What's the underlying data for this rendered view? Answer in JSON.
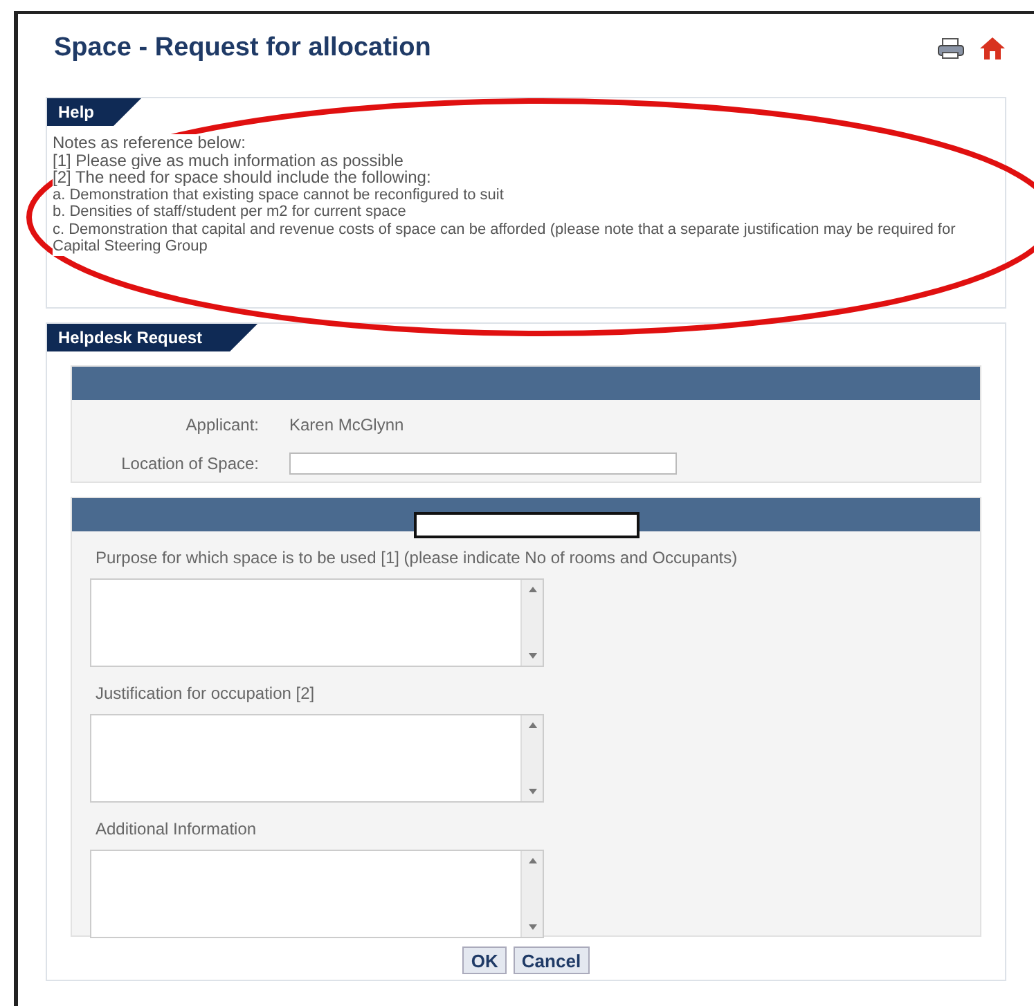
{
  "title": "Space - Request for allocation",
  "help": {
    "tab": "Help",
    "lines": [
      {
        "text": "Notes as reference below:",
        "kind": "note"
      },
      {
        "text": "[1] Please give as much information as possible",
        "kind": "note"
      },
      {
        "text": "[2] The need for space should include the following:",
        "kind": "note"
      },
      {
        "text": "a. Demonstration that existing space cannot be reconfigured to suit",
        "kind": "item"
      },
      {
        "text": "b. Densities of staff/student per m2 for current space",
        "kind": "item"
      },
      {
        "text": "c. Demonstration that capital and revenue costs of space can be afforded (please note that a separate justification may be required for Capital Steering Group",
        "kind": "item"
      }
    ]
  },
  "request": {
    "tab": "Helpdesk Request",
    "applicant": {
      "label": "Applicant:",
      "value": "Karen McGlynn"
    },
    "location": {
      "label": "Location of Space:"
    },
    "fields": [
      {
        "label": "Purpose for which space is to be used [1] (please indicate No of rooms and Occupants)"
      },
      {
        "label": "Justification for occupation [2]"
      },
      {
        "label": "Additional Information"
      }
    ]
  },
  "buttons": [
    "OK",
    "Cancel"
  ]
}
